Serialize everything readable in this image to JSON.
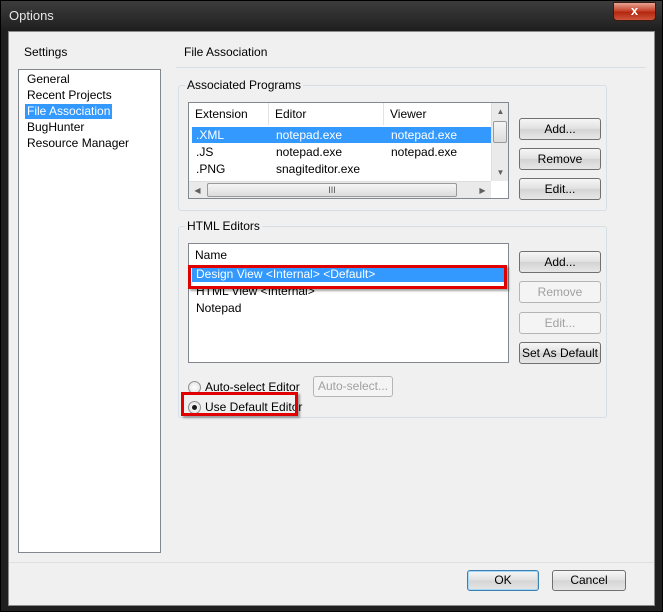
{
  "window": {
    "title": "Options",
    "close_glyph": "x"
  },
  "settings": {
    "label": "Settings",
    "items": [
      "General",
      "Recent Projects",
      "File Association",
      "BugHunter",
      "Resource Manager"
    ],
    "selected_index": 2
  },
  "panel": {
    "title": "File Association"
  },
  "associated_programs": {
    "title": "Associated Programs",
    "columns": [
      "Extension",
      "Editor",
      "Viewer"
    ],
    "rows": [
      {
        "extension": ".XML",
        "editor": "notepad.exe",
        "viewer": "notepad.exe"
      },
      {
        "extension": ".JS",
        "editor": "notepad.exe",
        "viewer": "notepad.exe"
      },
      {
        "extension": ".PNG",
        "editor": "snagiteditor.exe",
        "viewer": ""
      }
    ],
    "buttons": {
      "add": "Add...",
      "remove": "Remove",
      "edit": "Edit..."
    },
    "hscroll_thumb_glyph": "III"
  },
  "html_editors": {
    "title": "HTML Editors",
    "column": "Name",
    "rows": [
      "Design View <Internal> <Default>",
      "HTML View <Internal>",
      "Notepad"
    ],
    "buttons": {
      "add": "Add...",
      "remove": "Remove",
      "edit": "Edit...",
      "set_default": "Set As Default"
    },
    "radio_auto": "Auto-select Editor",
    "auto_select_button": "Auto-select...",
    "radio_default": "Use Default Editor"
  },
  "footer": {
    "ok": "OK",
    "cancel": "Cancel"
  },
  "colors": {
    "highlight": "#3399ff",
    "annotation": "#e00000"
  }
}
